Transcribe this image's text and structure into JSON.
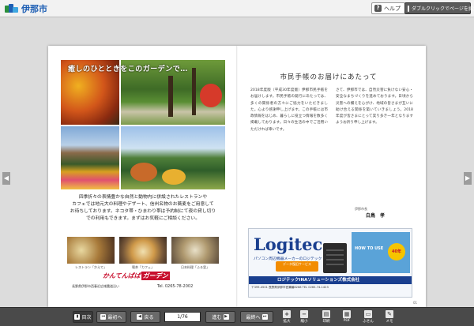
{
  "header": {
    "logo_text": "伊那市",
    "help_label": "ヘルプ",
    "zoom_hint": "ダブルクリックでページを拡大"
  },
  "left_page": {
    "ad_title": "癒しのひとときをこのガーデンで…",
    "ad_body_lines": [
      "四季折々の表情豊かな自然と動物内に併設されたレストランや",
      "カフェでは地元大の料理やデザート、信州名物のお蕎麦をご用意して",
      "お待ちしております。ネコタ帯・ひまわり帯は予約制にて夜の貸し切り",
      "での利用もできます。まずはお気軽にご相談ください。"
    ],
    "food_captions": [
      "レストラン「かえで」",
      "喫茶「カフェ」",
      "日本料理「ふる里」"
    ],
    "shop_name_left": "かんてんぱぱ",
    "shop_name_right": "ガーデン",
    "shop_address": "長野県伊那市西春近広域農道沿い",
    "shop_tel": "Tel. 0265-78-2002"
  },
  "right_page": {
    "title": "市民手帳のお届けにあたって",
    "col1": "2018年度版（平成30年度版）伊那市民手帳をお届けします。市民手帳の発行にあたっては、多くの関係者の方々にご協力をいただきました。心より感謝申し上げます。この手帳には市政情報をはじめ、暮らしに役立つ情報を数多く掲載しております。日々の生活の中でご活用いただければ幸いです。",
    "col2": "さて、伊那市では、自然災害に負けない安心・安全なまちづくりを進めております。日頃から災害への備えを心がけ、地域の皆さまが互いに助け合える関係を築いていきましょう。2018年度が皆さまにとって実り多き一年となりますようお祈り申し上げます。",
    "signature_label": "伊那市長",
    "signature_name": "白鳥　孝",
    "page_number": "01"
  },
  "logitec_ad": {
    "logo": "Logitec",
    "subtitle": "パソコン周辺機器メーカーのロジテック",
    "banner_text": "HOW TO USE",
    "badge": "40年",
    "pill_text": "データ復旧サービス",
    "bar_text": "ロジテックINAソリューションズ株式会社",
    "footer": "〒399-4501 長野県伊那市西箕輪8268 TEL 0265-74-1423"
  },
  "bottom_bar": {
    "toc_label": "目次",
    "first_label": "最初へ",
    "prev_label": "戻る",
    "page_indicator": "1/76",
    "next_label": "進む",
    "last_label": "最終へ",
    "zoom_in_label": "拡大",
    "zoom_out_label": "縮小",
    "print_label": "印刷",
    "pdf_label": "PDF",
    "memo_label": "ふせん",
    "note_label": "メモ"
  }
}
